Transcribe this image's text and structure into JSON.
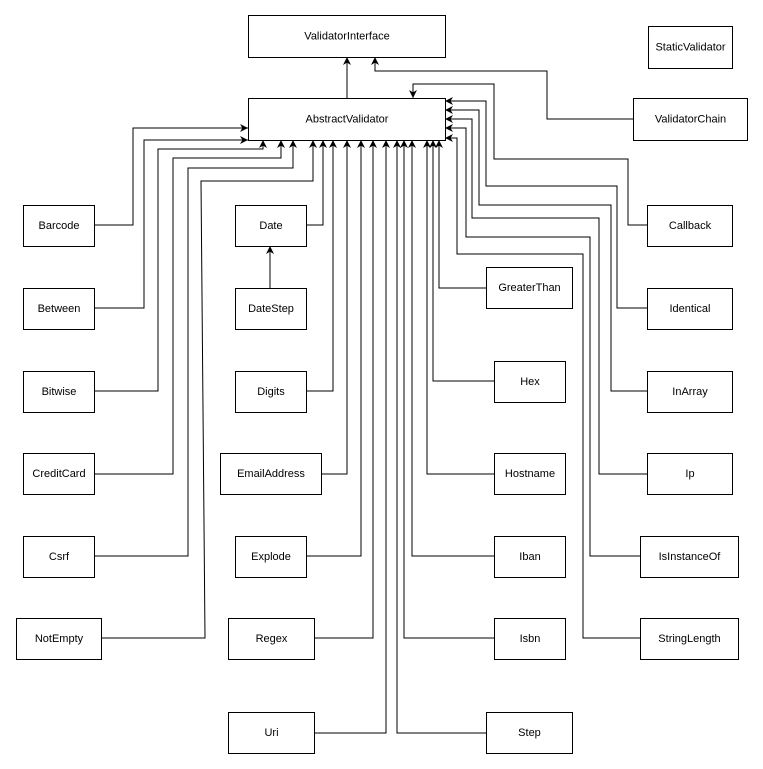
{
  "diagram": {
    "type": "uml-class-inheritance",
    "line_color": "#000000",
    "background": "#ffffff",
    "classes": [
      {
        "id": "vi",
        "label": "ValidatorInterface"
      },
      {
        "id": "av",
        "label": "AbstractValidator"
      },
      {
        "id": "sv",
        "label": "StaticValidator"
      },
      {
        "id": "vc",
        "label": "ValidatorChain"
      },
      {
        "id": "barcode",
        "label": "Barcode"
      },
      {
        "id": "between",
        "label": "Between"
      },
      {
        "id": "bitwise",
        "label": "Bitwise"
      },
      {
        "id": "creditcard",
        "label": "CreditCard"
      },
      {
        "id": "csrf",
        "label": "Csrf"
      },
      {
        "id": "notempty",
        "label": "NotEmpty"
      },
      {
        "id": "date",
        "label": "Date"
      },
      {
        "id": "datestep",
        "label": "DateStep"
      },
      {
        "id": "digits",
        "label": "Digits"
      },
      {
        "id": "email",
        "label": "EmailAddress"
      },
      {
        "id": "explode",
        "label": "Explode"
      },
      {
        "id": "regex",
        "label": "Regex"
      },
      {
        "id": "uri",
        "label": "Uri"
      },
      {
        "id": "greaterthan",
        "label": "GreaterThan"
      },
      {
        "id": "hex",
        "label": "Hex"
      },
      {
        "id": "hostname",
        "label": "Hostname"
      },
      {
        "id": "iban",
        "label": "Iban"
      },
      {
        "id": "isbn",
        "label": "Isbn"
      },
      {
        "id": "step",
        "label": "Step"
      },
      {
        "id": "callback",
        "label": "Callback"
      },
      {
        "id": "identical",
        "label": "Identical"
      },
      {
        "id": "inarray",
        "label": "InArray"
      },
      {
        "id": "ip",
        "label": "Ip"
      },
      {
        "id": "isinstanceof",
        "label": "IsInstanceOf"
      },
      {
        "id": "stringlength",
        "label": "StringLength"
      }
    ],
    "edges": [
      {
        "from": "av",
        "to": "vi"
      },
      {
        "from": "vc",
        "to": "vi"
      },
      {
        "from": "callback",
        "to": "av"
      },
      {
        "from": "identical",
        "to": "av"
      },
      {
        "from": "inarray",
        "to": "av"
      },
      {
        "from": "ip",
        "to": "av"
      },
      {
        "from": "isinstanceof",
        "to": "av"
      },
      {
        "from": "stringlength",
        "to": "av"
      },
      {
        "from": "greaterthan",
        "to": "av"
      },
      {
        "from": "hex",
        "to": "av"
      },
      {
        "from": "hostname",
        "to": "av"
      },
      {
        "from": "iban",
        "to": "av"
      },
      {
        "from": "isbn",
        "to": "av"
      },
      {
        "from": "step",
        "to": "av"
      },
      {
        "from": "uri",
        "to": "av"
      },
      {
        "from": "regex",
        "to": "av"
      },
      {
        "from": "explode",
        "to": "av"
      },
      {
        "from": "email",
        "to": "av"
      },
      {
        "from": "digits",
        "to": "av"
      },
      {
        "from": "date",
        "to": "av"
      },
      {
        "from": "datestep",
        "to": "date"
      },
      {
        "from": "barcode",
        "to": "av"
      },
      {
        "from": "between",
        "to": "av"
      },
      {
        "from": "bitwise",
        "to": "av"
      },
      {
        "from": "creditcard",
        "to": "av"
      },
      {
        "from": "csrf",
        "to": "av"
      },
      {
        "from": "notempty",
        "to": "av"
      }
    ]
  }
}
